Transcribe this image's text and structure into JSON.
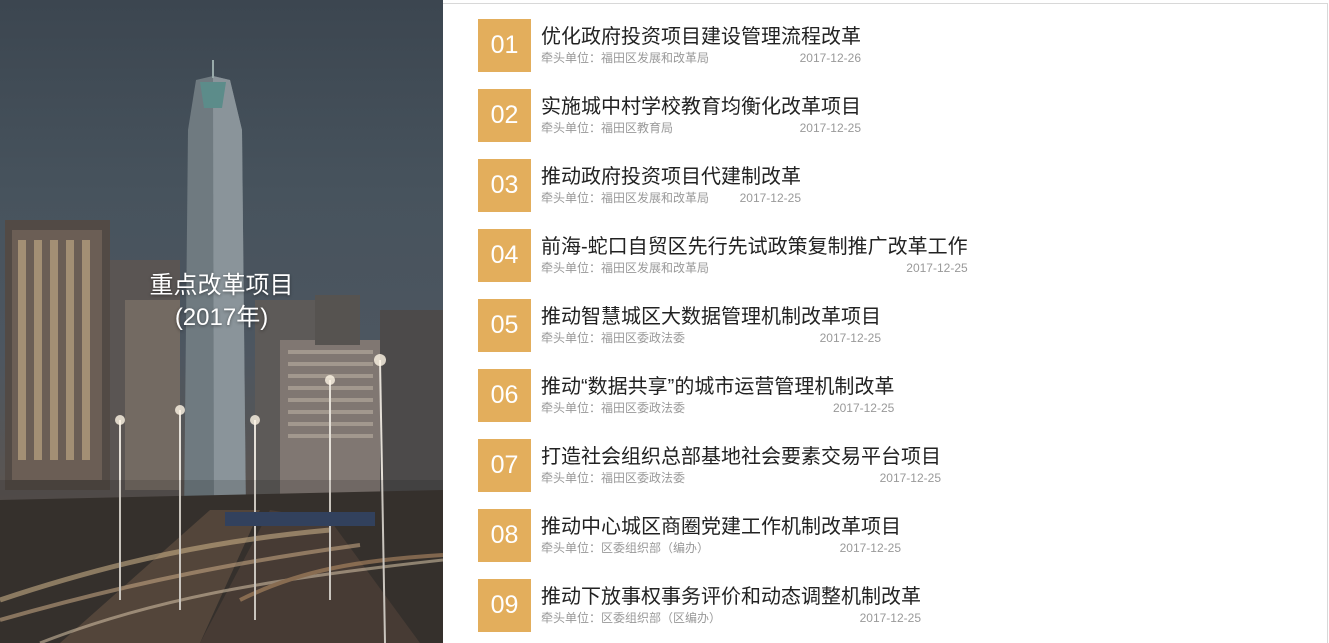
{
  "banner": {
    "title_line1": "重点改革项目",
    "title_line2": "(2017年)"
  },
  "list": {
    "items": [
      {
        "num": "01",
        "title": "优化政府投资项目建设管理流程改革",
        "dept": "牵头单位：福田区发展和改革局",
        "date": "2017-12-26"
      },
      {
        "num": "02",
        "title": "实施城中村学校教育均衡化改革项目",
        "dept": "牵头单位：福田区教育局",
        "date": "2017-12-25"
      },
      {
        "num": "03",
        "title": "推动政府投资项目代建制改革",
        "dept": "牵头单位：福田区发展和改革局",
        "date": "2017-12-25"
      },
      {
        "num": "04",
        "title": "前海-蛇口自贸区先行先试政策复制推广改革工作",
        "dept": "牵头单位：福田区发展和改革局",
        "date": "2017-12-25"
      },
      {
        "num": "05",
        "title": "推动智慧城区大数据管理机制改革项目",
        "dept": "牵头单位：福田区委政法委",
        "date": "2017-12-25"
      },
      {
        "num": "06",
        "title": "推动“数据共享”的城市运营管理机制改革",
        "dept": "牵头单位：福田区委政法委",
        "date": "2017-12-25"
      },
      {
        "num": "07",
        "title": "打造社会组织总部基地社会要素交易平台项目",
        "dept": "牵头单位：福田区委政法委",
        "date": "2017-12-25"
      },
      {
        "num": "08",
        "title": "推动中心城区商圈党建工作机制改革项目",
        "dept": "牵头单位：区委组织部（编办）",
        "date": "2017-12-25"
      },
      {
        "num": "09",
        "title": "推动下放事权事务评价和动态调整机制改革",
        "dept": "牵头单位：区委组织部（区编办）",
        "date": "2017-12-25"
      }
    ]
  }
}
